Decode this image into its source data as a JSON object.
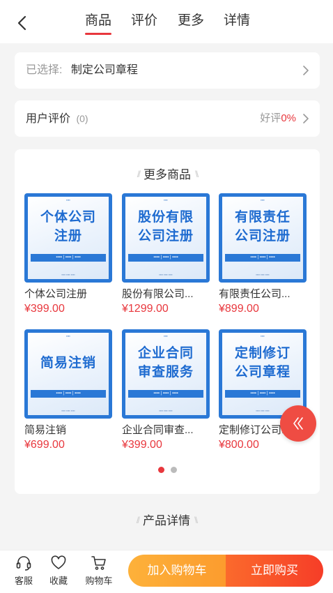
{
  "nav": {
    "tabs": [
      {
        "label": "商品",
        "active": true
      },
      {
        "label": "评价",
        "active": false
      },
      {
        "label": "更多",
        "active": false
      },
      {
        "label": "详情",
        "active": false
      }
    ]
  },
  "selection": {
    "prefix": "已选择:",
    "value": "制定公司章程"
  },
  "reviews": {
    "label": "用户评价",
    "count": "(0)",
    "rate_label": "好评",
    "rate_value": "0%"
  },
  "more_products": {
    "title": "更多商品",
    "items": [
      {
        "name": "个体公司注册",
        "price": "¥399.00",
        "thumb_lines": [
          "个体公司",
          "注册"
        ]
      },
      {
        "name": "股份有限公司...",
        "price": "¥1299.00",
        "thumb_lines": [
          "股份有限",
          "公司注册"
        ]
      },
      {
        "name": "有限责任公司...",
        "price": "¥899.00",
        "thumb_lines": [
          "有限责任",
          "公司注册"
        ]
      },
      {
        "name": "简易注销",
        "price": "¥699.00",
        "thumb_lines": [
          "简易注销",
          ""
        ]
      },
      {
        "name": "企业合同审查...",
        "price": "¥399.00",
        "thumb_lines": [
          "企业合同",
          "审查服务"
        ]
      },
      {
        "name": "定制修订公司...",
        "price": "¥800.00",
        "thumb_lines": [
          "定制修订",
          "公司章程"
        ]
      }
    ],
    "pagination": {
      "pages": 2,
      "current": 1
    }
  },
  "product_detail": {
    "title": "产品详情"
  },
  "bottom_bar": {
    "service_label": "客服",
    "favorite_label": "收藏",
    "cart_label": "购物车",
    "add_to_cart": "加入购物车",
    "buy_now": "立即购买"
  },
  "colors": {
    "accent": "#e8373d",
    "cart_button": "#fca533",
    "buy_button": "#f6472a",
    "thumb_blue": "#2a78d6"
  }
}
